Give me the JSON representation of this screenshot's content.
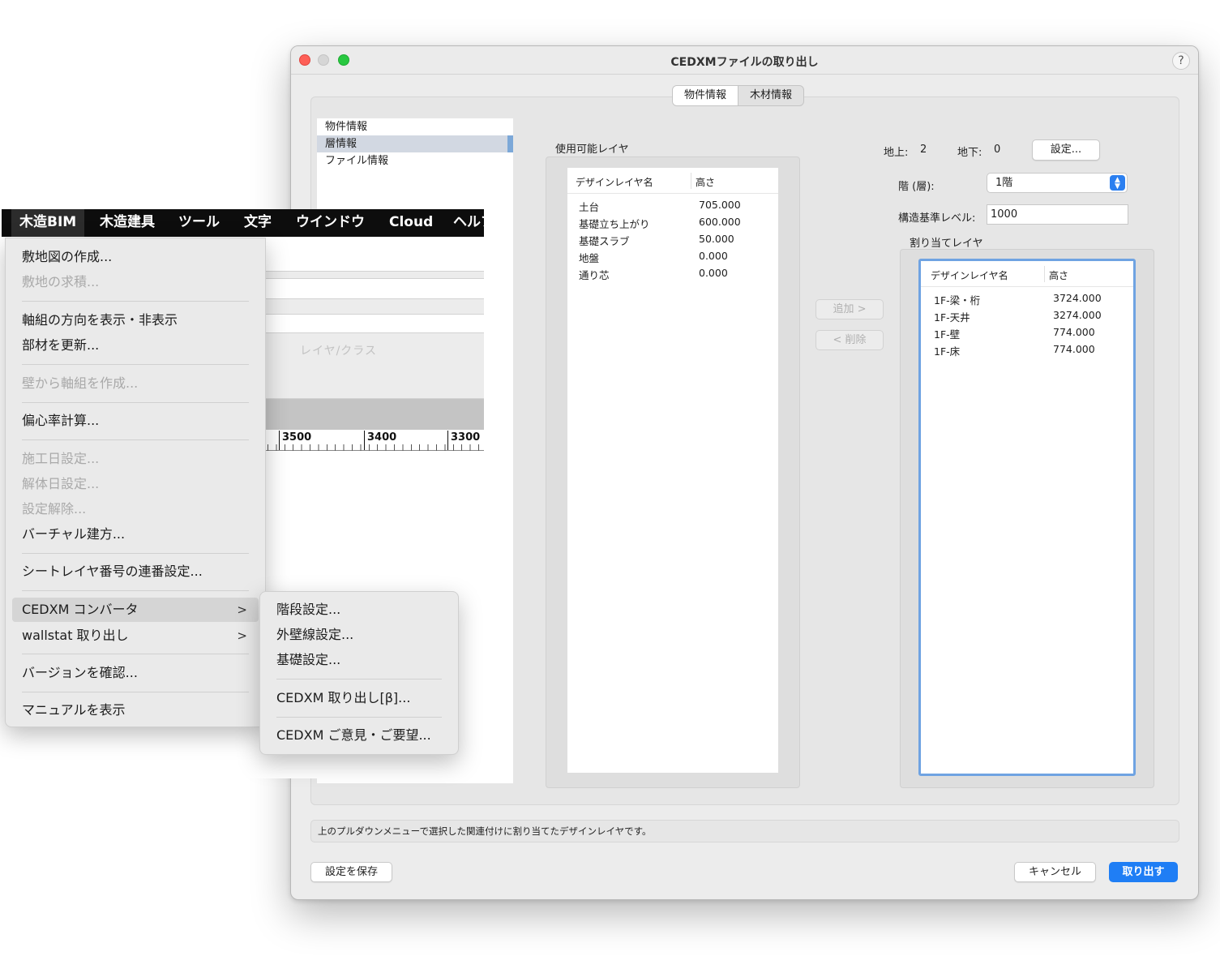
{
  "dialog": {
    "title": "CEDXMファイルの取り出し",
    "help": "?",
    "tabs": [
      {
        "label": "物件情報",
        "active": true
      },
      {
        "label": "木材情報",
        "active": false
      }
    ],
    "nav": [
      "物件情報",
      "層情報",
      "ファイル情報"
    ],
    "nav_selected_index": 1,
    "available_label": "使用可能レイヤ",
    "available_table": {
      "headers": [
        "デザインレイヤ名",
        "高さ"
      ],
      "rows": [
        {
          "name": "土台",
          "height": "705.000"
        },
        {
          "name": "基礎立ち上がり",
          "height": "600.000"
        },
        {
          "name": "基礎スラブ",
          "height": "50.000"
        },
        {
          "name": "地盤",
          "height": "0.000"
        },
        {
          "name": "通り芯",
          "height": "0.000"
        }
      ]
    },
    "add_button": "追加 >",
    "remove_button": "< 削除",
    "above_label": "地上:",
    "above_value": "2",
    "below_label": "地下:",
    "below_value": "0",
    "settings_button": "設定...",
    "floor_label": "階 (層):",
    "floor_value": "1階",
    "level_label": "構造基準レベル:",
    "level_value": "1000",
    "assigned_label": "割り当てレイヤ",
    "assigned_table": {
      "headers": [
        "デザインレイヤ名",
        "高さ"
      ],
      "rows": [
        {
          "name": "1F-梁・桁",
          "height": "3724.000"
        },
        {
          "name": "1F-天井",
          "height": "3274.000"
        },
        {
          "name": "1F-壁",
          "height": "774.000"
        },
        {
          "name": "1F-床",
          "height": "774.000"
        }
      ]
    },
    "status_text": "上のプルダウンメニューで選択した関連付けに割り当てたデザインレイヤです。",
    "save_button": "設定を保存",
    "cancel_button": "キャンセル",
    "export_button": "取り出す",
    "accent_color": "#1f7ef5"
  },
  "canvas": {
    "label": "レイヤ/クラス",
    "ruler": [
      "3500",
      "3400",
      "3300"
    ]
  },
  "menubar": {
    "items": [
      "木造BIM",
      "木造建具",
      "ツール",
      "文字",
      "ウインドウ",
      "Cloud",
      "ヘルプ"
    ],
    "active_index": 0
  },
  "menu": {
    "items": [
      {
        "label": "敷地図の作成...",
        "disabled": false
      },
      {
        "label": "敷地の求積...",
        "disabled": true
      },
      {
        "label": "軸組の方向を表示・非表示",
        "disabled": false
      },
      {
        "label": "部材を更新...",
        "disabled": false
      },
      {
        "label": "壁から軸組を作成...",
        "disabled": true
      },
      {
        "label": "偏心率計算...",
        "disabled": false
      },
      {
        "label": "施工日設定...",
        "disabled": true
      },
      {
        "label": "解体日設定...",
        "disabled": true
      },
      {
        "label": "設定解除...",
        "disabled": true
      },
      {
        "label": "バーチャル建方...",
        "disabled": false
      },
      {
        "label": "シートレイヤ番号の連番設定...",
        "disabled": false
      },
      {
        "label": "CEDXM コンバータ",
        "disabled": false,
        "submenu": true,
        "highlighted": true
      },
      {
        "label": "wallstat 取り出し",
        "disabled": false,
        "submenu": true
      },
      {
        "label": "バージョンを確認...",
        "disabled": false
      },
      {
        "label": "マニュアルを表示",
        "disabled": false
      }
    ],
    "arrow": ">"
  },
  "submenu": {
    "items": [
      {
        "label": "階段設定..."
      },
      {
        "label": "外壁線設定..."
      },
      {
        "label": "基礎設定..."
      },
      {
        "label": "CEDXM 取り出し[β]..."
      },
      {
        "label": "CEDXM ご意見・ご要望..."
      }
    ]
  }
}
